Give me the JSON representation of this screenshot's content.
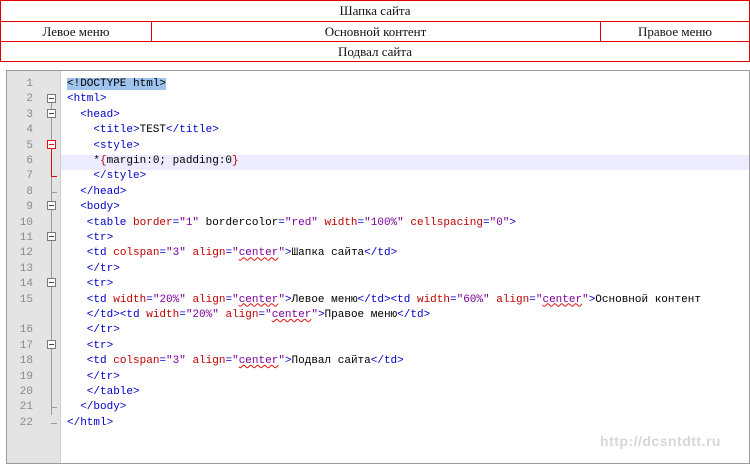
{
  "preview": {
    "header": "Шапка сайта",
    "left_menu": "Левое меню",
    "main_content": "Основной контент",
    "right_menu": "Правое меню",
    "footer": "Подвал сайта",
    "border_color": "#e00000"
  },
  "editor": {
    "line_numbers": [
      "1",
      "2",
      "3",
      "4",
      "5",
      "6",
      "7",
      "8",
      "9",
      "10",
      "11",
      "12",
      "13",
      "14",
      "15",
      "",
      "16",
      "17",
      "18",
      "19",
      "20",
      "21",
      "22"
    ],
    "lines": [
      "<!DOCTYPE html>",
      "<html>",
      "<head>",
      "<title>TEST</title>",
      "<style>",
      "*{margin:0; padding:0}",
      "</style>",
      "</head>",
      "<body>",
      "<table border=\"1\" bordercolor=\"red\" width=\"100%\" cellspacing=\"0\">",
      "<tr>",
      "<td colspan=\"3\" align=\"center\">Шапка сайта</td>",
      "</tr>",
      "<tr>",
      "<td width=\"20%\" align=\"center\">Левое меню</td><td width=\"60%\" align=\"center\">Основной контент",
      "</td><td width=\"20%\" align=\"center\">Правое меню</td>",
      "</tr>",
      "<tr>",
      "<td colspan=\"3\" align=\"center\">Подвал сайта</td>",
      "</tr>",
      "</table>",
      "</body>",
      "</html>"
    ],
    "highlighted_line": "6",
    "colors": {
      "tag": "#0000c8",
      "attribute": "#c00000",
      "value": "#7b0099",
      "highlight": "#ecebff"
    }
  },
  "watermark": "http://dcsntdtt.ru"
}
